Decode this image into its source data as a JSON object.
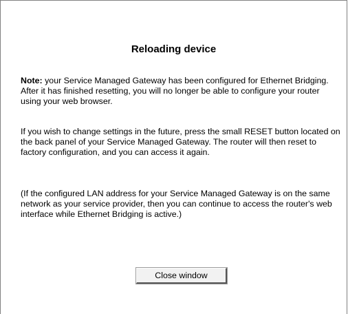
{
  "dialog": {
    "title": "Reloading device",
    "note_label": "Note:",
    "note_text": " your Service Managed Gateway has been configured for Ethernet Bridging. After it has finished resetting, you will no longer be able to configure your router using your web browser.",
    "paragraph_2": "If you wish to change settings in the future, press the small RESET button located on the back panel of your Service Managed Gateway. The router will then reset to factory configuration, and you can access it again.",
    "paragraph_3": "(If the configured LAN address for your Service Managed Gateway is on the same network as your service provider, then you can continue to access the router's web interface while Ethernet Bridging is active.)",
    "close_button_label": "Close window"
  },
  "colors": {
    "background": "#ffffff",
    "text": "#000000",
    "border": "#808080"
  }
}
